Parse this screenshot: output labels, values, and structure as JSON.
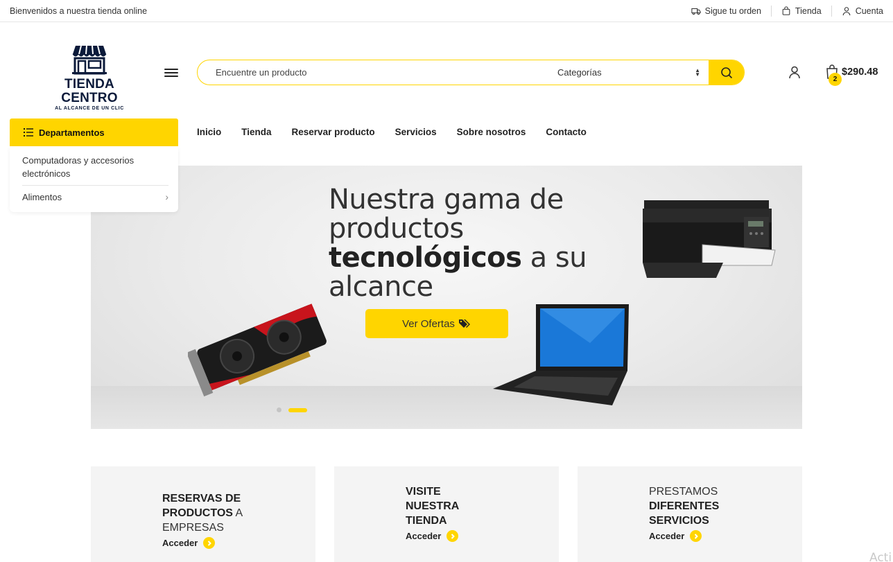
{
  "topbar": {
    "welcome": "Bienvenidos a nuestra tienda online",
    "links": [
      {
        "label": "Sigue tu orden",
        "icon": "truck-icon"
      },
      {
        "label": "Tienda",
        "icon": "bag-icon"
      },
      {
        "label": "Cuenta",
        "icon": "user-icon"
      }
    ]
  },
  "logo": {
    "name": "TIENDA CENTRO",
    "tagline": "AL ALCANCE DE UN CLIC"
  },
  "search": {
    "placeholder": "Encuentre un producto",
    "category_label": "Categorías"
  },
  "cart": {
    "count": "2",
    "total": "$290.48"
  },
  "departments": {
    "button_label": "Departamentos",
    "items": [
      {
        "label": "Computadoras y accesorios electrónicos"
      },
      {
        "label": "Alimentos"
      }
    ]
  },
  "nav": {
    "items": [
      "Inicio",
      "Tienda",
      "Reservar producto",
      "Servicios",
      "Sobre nosotros",
      "Contacto"
    ]
  },
  "hero": {
    "line1": "Nuestra gama de",
    "line2": "productos",
    "line3_bold": "tecnológicos",
    "line3_rest": " a su",
    "line4": "alcance",
    "cta": "Ver Ofertas",
    "slides_total": 2,
    "active_slide": 2
  },
  "cards": [
    {
      "bold": "RESERVAS DE PRODUCTOS",
      "rest": " A EMPRESAS",
      "link": "Acceder"
    },
    {
      "bold": "VISITE NUESTRA TIENDA",
      "rest": "",
      "link": "Acceder"
    },
    {
      "light": "PRESTAMOS",
      "bold": "DIFERENTES SERVICIOS",
      "link": "Acceder"
    }
  ],
  "watermark": "Acti",
  "colors": {
    "accent": "#ffd500",
    "brand_navy": "#0b1a3a",
    "text": "#222222"
  }
}
